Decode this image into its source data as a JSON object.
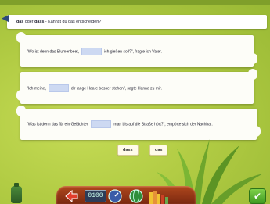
{
  "header": {
    "instruction_bold_1": "das",
    "instruction_mid": " oder ",
    "instruction_bold_2": "dass",
    "instruction_rest": " - Kannst du das entscheiden?"
  },
  "sentences": [
    {
      "before": "\"Wo ist denn das Blumenbeet,",
      "after": "ich gießen soll?\", fragte ich Vater."
    },
    {
      "before": "\"Ich meine,",
      "after": "dir lange Haare besser stehen\", sagte Hanna zu mir."
    },
    {
      "before": "\"Was ist denn das für ein Gelächter,",
      "after": "man bis auf die Straße hört?\", empörte sich der Nachbar."
    }
  ],
  "options": {
    "dass": "dass",
    "das": "das"
  },
  "toolbar": {
    "clock": "0100",
    "check": "✔"
  },
  "icons": [
    "back-arrow-icon",
    "bottle-icon",
    "arrow-tool-icon",
    "clock-display",
    "gauge-icon",
    "globe-icon",
    "bars-icon",
    "check-icon"
  ],
  "colors": {
    "background": "#b2cc44",
    "blank": "#cdd9f2",
    "dock": "#9a3a16"
  }
}
